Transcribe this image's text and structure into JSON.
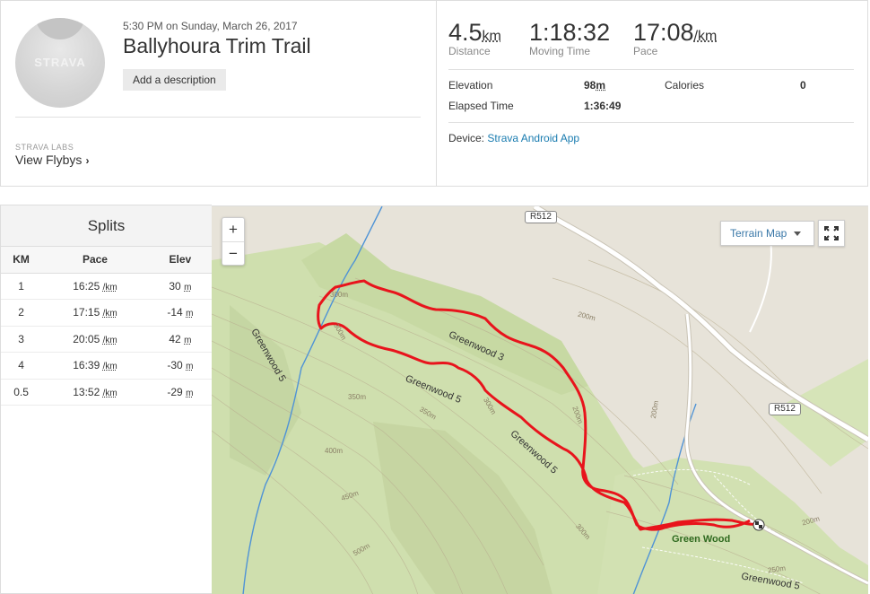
{
  "activity": {
    "date": "5:30 PM on Sunday, March 26, 2017",
    "title": "Ballyhoura Trim Trail",
    "add_description": "Add a description",
    "avatar_brand": "STRAVA",
    "labs_label": "STRAVA LABS",
    "flyby_label": "View Flybys",
    "flyby_chevron": "›"
  },
  "stats": {
    "distance": {
      "value": "4.5",
      "unit": "km",
      "label": "Distance"
    },
    "moving_time": {
      "value": "1:18:32",
      "label": "Moving Time"
    },
    "pace": {
      "value": "17:08",
      "unit": "/km",
      "label": "Pace"
    }
  },
  "more_stats": {
    "elevation_label": "Elevation",
    "elevation_value": "98",
    "elevation_unit": "m",
    "calories_label": "Calories",
    "calories_value": "0",
    "elapsed_label": "Elapsed Time",
    "elapsed_value": "1:36:49"
  },
  "device": {
    "label": "Device:",
    "name": "Strava Android App"
  },
  "splits": {
    "title": "Splits",
    "headers": [
      "KM",
      "Pace",
      "Elev"
    ],
    "pace_unit": "/km",
    "elev_unit": "m",
    "rows": [
      {
        "km": "1",
        "pace": "16:25",
        "elev": "30"
      },
      {
        "km": "2",
        "pace": "17:15",
        "elev": "-14"
      },
      {
        "km": "3",
        "pace": "20:05",
        "elev": "42"
      },
      {
        "km": "4",
        "pace": "16:39",
        "elev": "-30"
      },
      {
        "km": "0.5",
        "pace": "13:52",
        "elev": "-29"
      }
    ]
  },
  "map": {
    "zoom_in": "+",
    "zoom_out": "−",
    "terrain_label": "Terrain Map",
    "road_1": "R512",
    "road_2": "R512",
    "labels": {
      "greenwood3": "Greenwood 3",
      "greenwood5_a": "Greenwood 5",
      "greenwood5_b": "Greenwood 5",
      "greenwood5_c": "Greenwood 5",
      "greenwood5_d": "Greenwood 5",
      "green_wood": "Green Wood"
    },
    "contours": [
      "300m",
      "350m",
      "350m",
      "400m",
      "450m",
      "500m",
      "300m",
      "200m",
      "200m",
      "200m",
      "300m",
      "250m",
      "200m",
      "300m"
    ],
    "colors": {
      "route": "#e8141c",
      "water": "#4f93d6",
      "forest": "#cfdfae",
      "land": "#e7e3d9",
      "road": "#ffffff"
    }
  }
}
